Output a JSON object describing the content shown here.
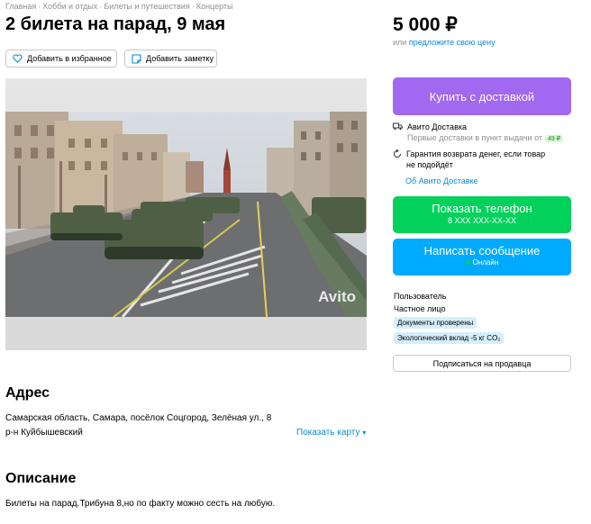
{
  "breadcrumb": [
    "Главная",
    "Хобби и отдых",
    "Билеты и путешествия",
    "Концерты"
  ],
  "listing": {
    "title": "2 билета на парад, 9 мая",
    "price": "5 000 ₽",
    "price_or": "или",
    "price_offer_link": "предложите свою цену"
  },
  "actions": {
    "favorite": "Добавить в избранное",
    "note": "Добавить заметку"
  },
  "photo": {
    "watermark": "Avito"
  },
  "sidebar": {
    "buy_button": "Купить с доставкой",
    "delivery_title": "Авито Доставка",
    "delivery_sub": "Первые доставки в пункт выдачи от",
    "delivery_badge": "49 ₽",
    "guarantee_line1": "Гарантия возврата денег, если товар",
    "guarantee_line2": "не подойдёт",
    "delivery_link": "Об Авито Доставке",
    "phone_button": "Показать телефон",
    "phone_masked": "8 XXX XXX-XX-XX",
    "message_button": "Написать сообщение",
    "online": "Онлайн",
    "seller_name": "Пользователь",
    "seller_type": "Частное лицо",
    "tag_docs": "Документы проверены",
    "tag_eco": "Экологический вклад -5 кг CO₂",
    "subscribe_button": "Подписаться на продавца"
  },
  "address": {
    "heading": "Адрес",
    "line1": "Самарская область, Самара, посёлок Соцгород, Зелёная ул., 8",
    "line2": "р-н Куйбышевский",
    "map_link": "Показать карту"
  },
  "description": {
    "heading": "Описание",
    "text": "Билеты на парад.Трибуна 8,но по факту можно сесть на любую."
  },
  "colors": {
    "buy": "#a168f0",
    "phone": "#02d15c",
    "message": "#00aaff",
    "link": "#0a89d6",
    "tag": "#d5eefc"
  },
  "icons": [
    "heart-icon",
    "note-icon",
    "truck-icon",
    "refresh-icon",
    "chevron-down-icon"
  ]
}
